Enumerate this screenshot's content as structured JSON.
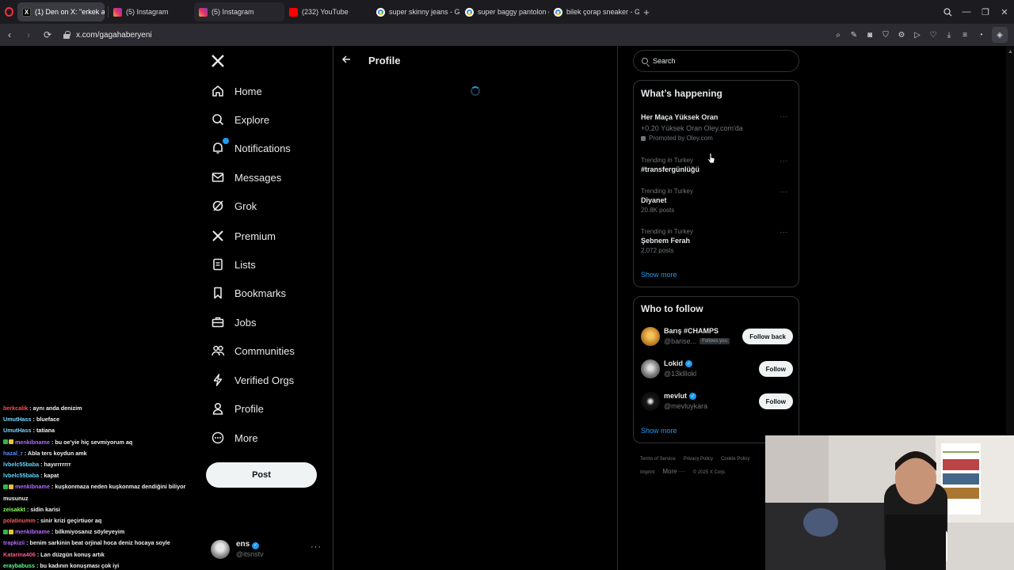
{
  "browser": {
    "tabs": [
      {
        "label": "(1) Den on X: \"erkek adam",
        "favicon": "x-icon",
        "active": true
      },
      {
        "label": "(5) Instagram",
        "favicon": "instagram-icon",
        "active": false
      },
      {
        "label": "(5) Instagram",
        "favicon": "instagram-icon",
        "active": false
      },
      {
        "label": "(232) YouTube",
        "favicon": "youtube-icon",
        "active": false
      },
      {
        "label": "super skinny jeans - Goog",
        "favicon": "google-icon",
        "active": false
      },
      {
        "label": "super baggy pantolon erk",
        "favicon": "google-icon",
        "active": false
      },
      {
        "label": "bilek çorap sneaker - Goo",
        "favicon": "google-icon",
        "active": false
      }
    ],
    "url": "x.com/gagahaberyeni"
  },
  "nav": {
    "items": [
      {
        "label": "Home",
        "icon": "home-icon"
      },
      {
        "label": "Explore",
        "icon": "search-icon"
      },
      {
        "label": "Notifications",
        "icon": "bell-icon"
      },
      {
        "label": "Messages",
        "icon": "envelope-icon"
      },
      {
        "label": "Grok",
        "icon": "grok-icon"
      },
      {
        "label": "Premium",
        "icon": "x-logo-icon"
      },
      {
        "label": "Lists",
        "icon": "list-icon"
      },
      {
        "label": "Bookmarks",
        "icon": "bookmark-icon"
      },
      {
        "label": "Jobs",
        "icon": "briefcase-icon"
      },
      {
        "label": "Communities",
        "icon": "people-icon"
      },
      {
        "label": "Verified Orgs",
        "icon": "lightning-icon"
      },
      {
        "label": "Profile",
        "icon": "person-icon"
      },
      {
        "label": "More",
        "icon": "more-circle-icon"
      }
    ],
    "post_label": "Post",
    "account": {
      "name": "ens",
      "handle": "@itsnstv"
    }
  },
  "main": {
    "title": "Profile"
  },
  "search": {
    "placeholder": "Search"
  },
  "happening": {
    "title": "What’s happening",
    "promoted": {
      "name": "Her Maça Yüksek Oran",
      "desc": "+0.20 Yüksek Oran Oley.com'da",
      "promo": "Promoted by Oley.com"
    },
    "trends": [
      {
        "category": "Trending in Turkey",
        "name": "#transfergünlüğü",
        "posts": ""
      },
      {
        "category": "Trending in Turkey",
        "name": "Diyanet",
        "posts": "20.8K posts"
      },
      {
        "category": "Trending in Turkey",
        "name": "Şebnem Ferah",
        "posts": "2,072 posts"
      }
    ],
    "show_more": "Show more"
  },
  "who_to_follow": {
    "title": "Who to follow",
    "users": [
      {
        "name": "Barış #CHAMPS",
        "handle": "@barise...",
        "follows_you": "Follows you",
        "button": "Follow back",
        "verified": false
      },
      {
        "name": "Lokid",
        "handle": "@13klllokl",
        "follows_you": "",
        "button": "Follow",
        "verified": true
      },
      {
        "name": "mevlut",
        "handle": "@mevluykara",
        "follows_you": "",
        "button": "Follow",
        "verified": true
      }
    ],
    "show_more": "Show more"
  },
  "footer": {
    "links": [
      "Terms of Service",
      "Privacy Policy",
      "Cookie Policy",
      "Imprint",
      "More ···",
      "© 2025 X Corp."
    ]
  },
  "chat": [
    {
      "user": "berkcalik",
      "color": "#ff4d4d",
      "msg": " : aynı anda denizim",
      "badges": []
    },
    {
      "user": "UmutHass",
      "color": "#7fd6ff",
      "msg": " : blueface",
      "badges": []
    },
    {
      "user": "UmutHass",
      "color": "#7fd6ff",
      "msg": " : tatiana",
      "badges": []
    },
    {
      "user": "menkibname",
      "color": "#b26cff",
      "msg": " : bu oe'yie hiç sevmiyorum aq",
      "badges": [
        "mod",
        "sub"
      ]
    },
    {
      "user": "hazal_r",
      "color": "#5b8cff",
      "msg": " : Abla ters koydun amk",
      "badges": []
    },
    {
      "user": "lvbelc55baba",
      "color": "#5fd4ff",
      "msg": " : hayırrrrrrr",
      "badges": []
    },
    {
      "user": "lvbelc55baba",
      "color": "#5fd4ff",
      "msg": " : kapat",
      "badges": []
    },
    {
      "user": "menkibname",
      "color": "#b26cff",
      "msg": " : kuşkonmaza neden kuşkonmaz dendiğini biliyor musunuz",
      "badges": [
        "mod",
        "sub"
      ]
    },
    {
      "user": "zeisakkt",
      "color": "#8cff5b",
      "msg": " : sidin karisi",
      "badges": []
    },
    {
      "user": "polatinumm",
      "color": "#ff5a5a",
      "msg": " : sinir krizi geçirtiuor aq",
      "badges": []
    },
    {
      "user": "menkibname",
      "color": "#b26cff",
      "msg": " : bilkmiyosanız söyleyeyim",
      "badges": [
        "mod",
        "sub"
      ]
    },
    {
      "user": "trapkizii",
      "color": "#b26cff",
      "msg": " : benim sarkinin beat orjinal hoca deniz hocaya soyle",
      "badges": []
    },
    {
      "user": "Katarina406",
      "color": "#ff5a8a",
      "msg": " : Lan düzgün konuş artık",
      "badges": []
    },
    {
      "user": "eraybabuss",
      "color": "#5bff8c",
      "msg": " : bu kadının konuşması çok iyi",
      "badges": []
    }
  ],
  "colors": {
    "accent": "#1d9bf0",
    "background": "#000000",
    "border": "#2f3336"
  }
}
